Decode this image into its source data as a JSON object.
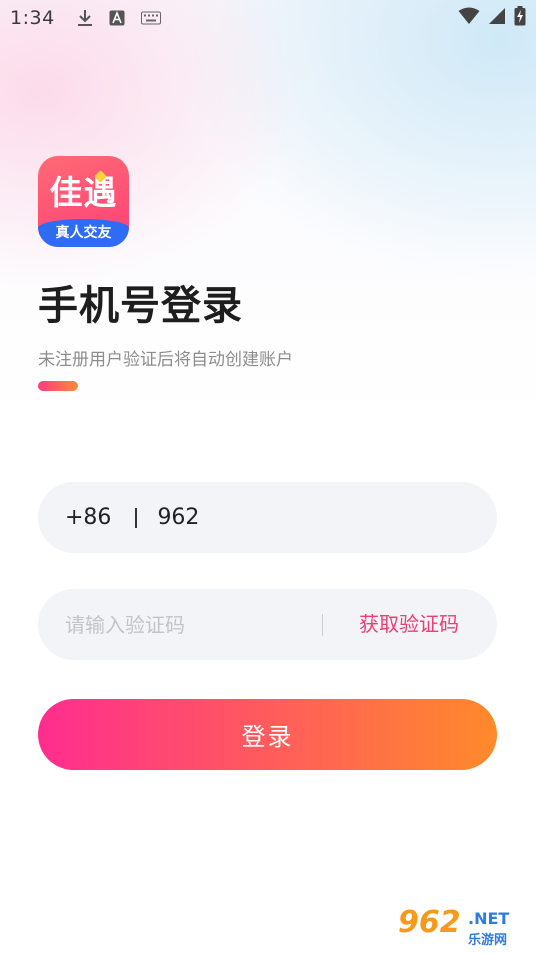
{
  "status_bar": {
    "time": "1:34",
    "left_icons": [
      "download-icon",
      "font-a-icon",
      "keyboard-icon"
    ],
    "right_icons": [
      "wifi-icon",
      "cell-signal-icon",
      "battery-charging-icon"
    ]
  },
  "logo": {
    "main_text": "佳遇",
    "band_text": "真人交友",
    "colors": {
      "top": "#ff5a76",
      "band": "#2f6cf6",
      "heart": "#ffd23c"
    }
  },
  "header": {
    "title": "手机号登录",
    "subtitle": "未注册用户验证后将自动创建账户"
  },
  "phone_field": {
    "country_code": "+86",
    "value": "962"
  },
  "code_field": {
    "placeholder": "请输入验证码",
    "value": "",
    "get_code_label": "获取验证码"
  },
  "login_button": {
    "label": "登录"
  },
  "watermark": {
    "number": "962",
    "net": ".NET",
    "chinese": "乐游网"
  },
  "colors": {
    "accent_pink": "#ff2d8f",
    "accent_orange": "#ff8a2a",
    "link_red": "#ee3d70",
    "field_bg": "#f3f4f8"
  }
}
